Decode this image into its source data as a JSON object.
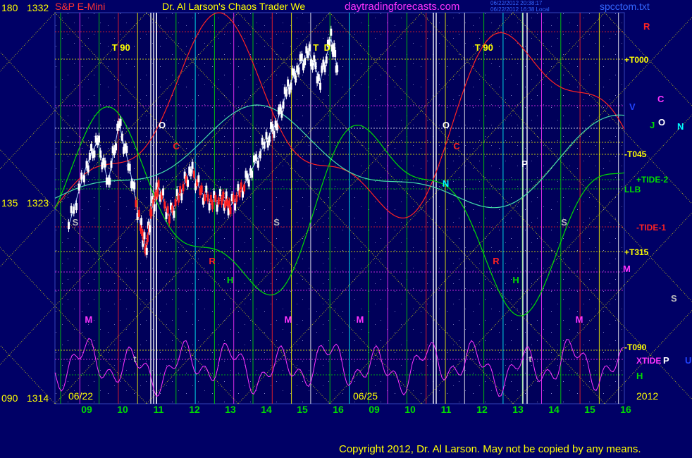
{
  "header": {
    "left_y_label": "180",
    "left_price": "1332",
    "instrument": "S&P E-Mini",
    "title": "Dr. Al Larson's Chaos Trader We",
    "site": "daytradingforecasts.com",
    "stamp_line1": "06/22/2012 20:38:17",
    "stamp_line2": "06/22/2012 16:38 Local",
    "file": "spcctom.txt"
  },
  "axis_labels": {
    "mid_y_label": "135",
    "mid_price": "1323",
    "bottom_y_label": "090",
    "bottom_price": "1314",
    "year": "2012",
    "date_left": "06/22",
    "date_right": "06/25"
  },
  "copyright": "Copyright 2012, Dr. Al Larson. May not be copied by any means.",
  "colors": {
    "background": "#000066",
    "yellow": "#ffff00",
    "green": "#00dd00",
    "magenta": "#ff33ff",
    "red": "#ff2222",
    "white": "#ffffff",
    "cyan": "#00ffff",
    "blue": "#2244ff"
  },
  "chart_data": {
    "type": "line",
    "ylabel": "",
    "ylim": [
      1314,
      1332
    ],
    "x_ticks": [
      "09",
      "10",
      "11",
      "12",
      "13",
      "14",
      "15",
      "16",
      "09",
      "10",
      "11",
      "12",
      "13",
      "14",
      "15",
      "16"
    ],
    "price_series": [
      {
        "hour": 8.5,
        "price": 1322.2
      },
      {
        "hour": 9.0,
        "price": 1325.0
      },
      {
        "hour": 9.3,
        "price": 1326.1
      },
      {
        "hour": 9.6,
        "price": 1324.2
      },
      {
        "hour": 9.9,
        "price": 1326.9
      },
      {
        "hour": 10.2,
        "price": 1324.8
      },
      {
        "hour": 10.5,
        "price": 1322.2
      },
      {
        "hour": 10.65,
        "price": 1321.1
      },
      {
        "hour": 10.8,
        "price": 1322.9
      },
      {
        "hour": 11.0,
        "price": 1324.0
      },
      {
        "hour": 11.3,
        "price": 1322.6
      },
      {
        "hour": 11.6,
        "price": 1323.7
      },
      {
        "hour": 11.9,
        "price": 1324.8
      },
      {
        "hour": 12.2,
        "price": 1323.7
      },
      {
        "hour": 12.5,
        "price": 1323.3
      },
      {
        "hour": 12.8,
        "price": 1323.4
      },
      {
        "hour": 13.0,
        "price": 1323.1
      },
      {
        "hour": 13.3,
        "price": 1323.8
      },
      {
        "hour": 13.6,
        "price": 1324.8
      },
      {
        "hour": 14.0,
        "price": 1326.1
      },
      {
        "hour": 14.3,
        "price": 1327.0
      },
      {
        "hour": 14.6,
        "price": 1328.5
      },
      {
        "hour": 14.9,
        "price": 1329.6
      },
      {
        "hour": 15.2,
        "price": 1330.1
      },
      {
        "hour": 15.5,
        "price": 1328.9
      },
      {
        "hour": 15.8,
        "price": 1330.8
      },
      {
        "hour": 16.0,
        "price": 1329.3
      }
    ],
    "line_labels": [
      "+T000",
      "-T045",
      "+TIDE-2",
      "LLB",
      "-TIDE-1",
      "+T315",
      "-T090",
      "XTIDE"
    ],
    "letter_markers": [
      {
        "text": "T  90",
        "color": "#ffff00",
        "day": 0,
        "hour": 9.7
      },
      {
        "text": "T  90",
        "color": "#ffff00",
        "day": 1,
        "hour": 11.8
      },
      {
        "text": "T",
        "color": "#ffff00",
        "day": 0,
        "hour": 15.3
      },
      {
        "text": "D",
        "color": "#ffff00",
        "day": 0,
        "hour": 15.6
      },
      {
        "text": "O",
        "color": "#ffffff",
        "day": 0,
        "hour": 11.0
      },
      {
        "text": "O",
        "color": "#ffffff",
        "day": 1,
        "hour": 10.9
      },
      {
        "text": "C",
        "color": "#ff2222",
        "day": 0,
        "hour": 11.4
      },
      {
        "text": "C",
        "color": "#ff2222",
        "day": 1,
        "hour": 11.2
      },
      {
        "text": "R",
        "color": "#ff2222",
        "day": 0,
        "hour": 12.4
      },
      {
        "text": "R",
        "color": "#ff2222",
        "day": 1,
        "hour": 12.3
      },
      {
        "text": "H",
        "color": "#00dd00",
        "day": 0,
        "hour": 12.9
      },
      {
        "text": "H",
        "color": "#00dd00",
        "day": 1,
        "hour": 12.85
      },
      {
        "text": "S",
        "color": "#bbbbbb",
        "day": 0,
        "hour": 8.6
      },
      {
        "text": "S",
        "color": "#bbbbbb",
        "day": 0,
        "hour": 14.2
      },
      {
        "text": "S",
        "color": "#bbbbbb",
        "day": 1,
        "hour": 14.2
      },
      {
        "text": "M",
        "color": "#ff33ff",
        "day": 0,
        "hour": 8.95
      },
      {
        "text": "M",
        "color": "#ff33ff",
        "day": 0,
        "hour": 14.5
      },
      {
        "text": "M",
        "color": "#ff33ff",
        "day": 0,
        "hour": 16.5
      },
      {
        "text": "M",
        "color": "#ff33ff",
        "day": 1,
        "hour": 14.6
      },
      {
        "text": "N",
        "color": "#00ffff",
        "day": 1,
        "hour": 10.9
      },
      {
        "text": "P",
        "color": "#ffffff",
        "day": 1,
        "hour": 13.1
      },
      {
        "text": "t",
        "color": "#bbbbbb",
        "day": 0,
        "hour": 10.3
      },
      {
        "text": "t",
        "color": "#bbbbbb",
        "day": 1,
        "hour": 13.3
      }
    ],
    "right_margin_letters": [
      {
        "text": "R",
        "color": "#ff2222"
      },
      {
        "text": "C",
        "color": "#ff33ff"
      },
      {
        "text": "V",
        "color": "#2244ff"
      },
      {
        "text": "J",
        "color": "#00dd00"
      },
      {
        "text": "O",
        "color": "#ffffff"
      },
      {
        "text": "N",
        "color": "#00ffff"
      },
      {
        "text": "M",
        "color": "#ff33ff"
      },
      {
        "text": "S",
        "color": "#bbbbbb"
      },
      {
        "text": "P",
        "color": "#ffffff"
      },
      {
        "text": "U",
        "color": "#2244ff"
      },
      {
        "text": "H",
        "color": "#00dd00"
      }
    ]
  }
}
